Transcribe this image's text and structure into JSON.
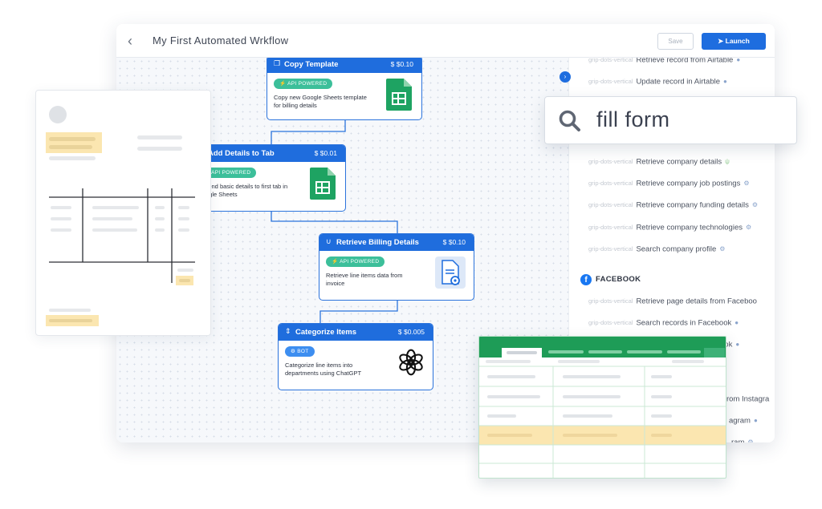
{
  "window": {
    "title": "My First Automated Wrkflow",
    "save_label": "Save",
    "launch_label": "Launch"
  },
  "sidebar": {
    "grip_label": "grip-dots-vertical",
    "facebook_label": "FACEBOOK",
    "facebook_logo": "f",
    "actions": [
      {
        "label": "Retrieve record from Airtable",
        "icon": "user-icon"
      },
      {
        "label": "Update record in Airtable",
        "icon": "user-icon"
      },
      {
        "label": "Retrieve company details",
        "icon": "plug-icon"
      },
      {
        "label": "Retrieve company job postings",
        "icon": "bot-icon"
      },
      {
        "label": "Retrieve company funding details",
        "icon": "bot-icon"
      },
      {
        "label": "Retrieve company technologies",
        "icon": "bot-icon"
      },
      {
        "label": "Search company profile",
        "icon": "bot-icon"
      },
      {
        "label": "Retrieve page details from Faceboo",
        "icon": "none"
      },
      {
        "label": "Search records in Facebook",
        "icon": "user-icon"
      },
      {
        "label": "ook",
        "icon": "user-icon"
      },
      {
        "label": "rom Instagra",
        "icon": "none"
      },
      {
        "label": "agram",
        "icon": "user-icon"
      },
      {
        "label": "ram",
        "icon": "bot-icon"
      }
    ]
  },
  "flow": {
    "nodes": [
      {
        "title": "Copy Template",
        "price": "$ $0.10",
        "badge": "API POWERED",
        "desc": "Copy new Google Sheets template for billing details",
        "icon": "google-sheets-icon"
      },
      {
        "title": "Add Details to Tab",
        "price": "$ $0.01",
        "badge": "API POWERED",
        "desc": "Append basic details to first tab in Google Sheets",
        "icon": "google-sheets-icon"
      },
      {
        "title": "Retrieve Billing Details",
        "price": "$ $0.10",
        "badge": "API POWERED",
        "desc": "Retrieve line items data from invoice",
        "icon": "document-settings-icon"
      },
      {
        "title": "Categorize Items",
        "price": "$ $0.005",
        "badge": "BOT",
        "desc": "Categorize line items into departments using ChatGPT",
        "icon": "openai-icon"
      }
    ]
  },
  "search": {
    "query": "fill form"
  },
  "colors": {
    "accent": "#1e6ddf",
    "api_badge": "#3cbf9a",
    "bot_badge": "#3d8ef0",
    "sheet_green": "#1e9c57",
    "highlight": "#fbe6b0"
  }
}
